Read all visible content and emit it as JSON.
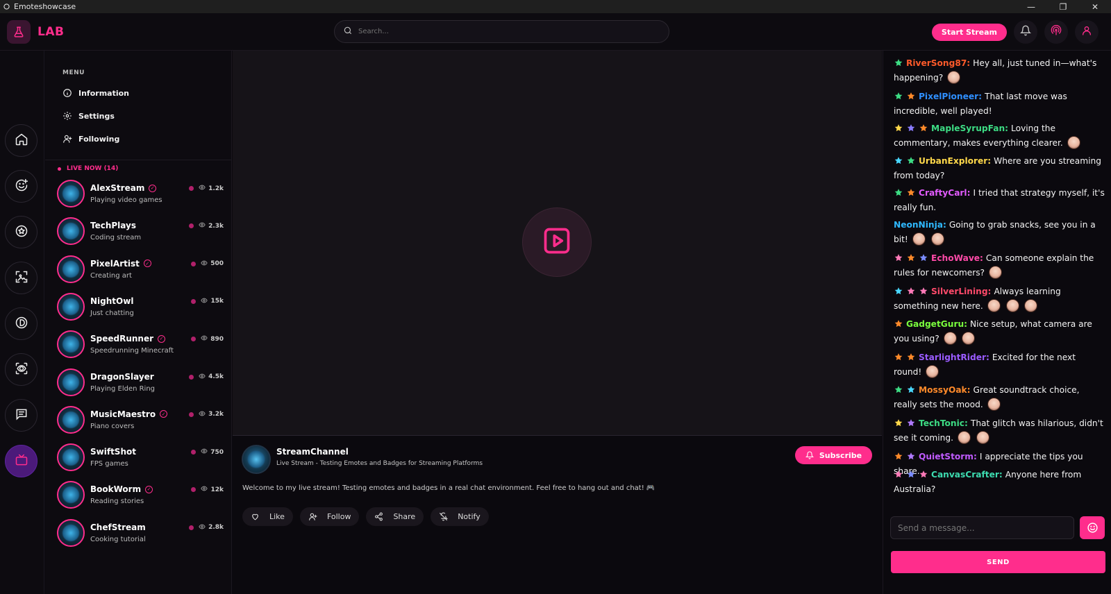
{
  "window": {
    "title": "Emoteshowcase",
    "controls": [
      "—",
      "❐",
      "✕"
    ]
  },
  "header": {
    "logo_text": "LAB",
    "search_placeholder": "Search...",
    "start_stream_label": "Start Stream",
    "accent": "#ff2d8c"
  },
  "menu": {
    "label": "MENU",
    "items": [
      {
        "label": "Information",
        "icon": "info-icon"
      },
      {
        "label": "Settings",
        "icon": "gear-icon"
      },
      {
        "label": "Following",
        "icon": "user-plus-icon"
      }
    ]
  },
  "live_now": {
    "label": "LIVE NOW (14)",
    "streams": [
      {
        "name": "AlexStream",
        "sub": "Playing video games",
        "viewers": "1.2k",
        "verified": true
      },
      {
        "name": "TechPlays",
        "sub": "Coding stream",
        "viewers": "2.3k",
        "verified": false
      },
      {
        "name": "PixelArtist",
        "sub": "Creating art",
        "viewers": "500",
        "verified": true
      },
      {
        "name": "NightOwl",
        "sub": "Just chatting",
        "viewers": "15k",
        "verified": false
      },
      {
        "name": "SpeedRunner",
        "sub": "Speedrunning Minecraft",
        "viewers": "890",
        "verified": true
      },
      {
        "name": "DragonSlayer",
        "sub": "Playing Elden Ring",
        "viewers": "4.5k",
        "verified": false
      },
      {
        "name": "MusicMaestro",
        "sub": "Piano covers",
        "viewers": "3.2k",
        "verified": true
      },
      {
        "name": "SwiftShot",
        "sub": "FPS games",
        "viewers": "750",
        "verified": false
      },
      {
        "name": "BookWorm",
        "sub": "Reading stories",
        "viewers": "12k",
        "verified": true
      },
      {
        "name": "ChefStream",
        "sub": "Cooking tutorial",
        "viewers": "2.8k",
        "verified": false
      }
    ]
  },
  "channel": {
    "name": "StreamChannel",
    "description": "Live Stream - Testing Emotes and Badges for Streaming Platforms",
    "subscribe_label": "Subscribe",
    "welcome": "Welcome to my live stream! Testing emotes and badges in a real chat environment. Feel free to hang out and chat! 🎮",
    "actions": [
      "Like",
      "Follow",
      "Share",
      "Notify"
    ]
  },
  "chat": {
    "messages": [
      {
        "user": "RiverSong87:",
        "color": "#ff5a2a",
        "badges": [
          "#3ddc84"
        ],
        "text": "Hey all, just tuned in—what's happening?",
        "emotes": 1
      },
      {
        "user": "PixelPioneer:",
        "color": "#2f8fff",
        "badges": [
          "#3ddc84",
          "#ff8a2a"
        ],
        "text": "That last move was incredible, well played!",
        "emotes": 0
      },
      {
        "user": "MapleSyrupFan:",
        "color": "#3ddc84",
        "badges": [
          "#ffd84a",
          "#8a7cff",
          "#ff8a2a"
        ],
        "text": "Loving the commentary, makes everything clearer.",
        "emotes": 1
      },
      {
        "user": "UrbanExplorer:",
        "color": "#ffd84a",
        "badges": [
          "#4ad8ff",
          "#3ddc84"
        ],
        "text": "Where are you streaming from today?",
        "emotes": 0
      },
      {
        "user": "CraftyCarl:",
        "color": "#e35bff",
        "badges": [
          "#3ddc84",
          "#ff8a2a"
        ],
        "text": "I tried that strategy myself, it's really fun.",
        "emotes": 0
      },
      {
        "user": "NeonNinja:",
        "color": "#2fb8ff",
        "badges": [],
        "text": "Going to grab snacks, see you in a bit!",
        "emotes": 2
      },
      {
        "user": "EchoWave:",
        "color": "#ff4aa8",
        "badges": [
          "#ff7ab8",
          "#ff8a2a",
          "#7a8cff"
        ],
        "text": "Can someone explain the rules for newcomers?",
        "emotes": 1
      },
      {
        "user": "SilverLining:",
        "color": "#ff4a6a",
        "badges": [
          "#4ad8ff",
          "#ff7ab8",
          "#ff7ab8"
        ],
        "text": "Always learning something new here.",
        "emotes": 3
      },
      {
        "user": "GadgetGuru:",
        "color": "#7aff3d",
        "badges": [
          "#ff8a2a"
        ],
        "text": "Nice setup, what camera are you using?",
        "emotes": 2
      },
      {
        "user": "StarlightRider:",
        "color": "#9a5bff",
        "badges": [
          "#ff8a2a",
          "#ff8a2a"
        ],
        "text": "Excited for the next round!",
        "emotes": 1
      },
      {
        "user": "MossyOak:",
        "color": "#ff8a2a",
        "badges": [
          "#3ddc84",
          "#4ad8ff"
        ],
        "text": "Great soundtrack choice, really sets the mood.",
        "emotes": 1
      },
      {
        "user": "TechTonic:",
        "color": "#3ddc84",
        "badges": [
          "#ffd84a",
          "#b07aff"
        ],
        "text": "That glitch was hilarious, didn't see it coming.",
        "emotes": 2
      },
      {
        "user": "QuietStorm:",
        "color": "#c05bff",
        "badges": [
          "#ff8a2a",
          "#b07aff"
        ],
        "text": "I appreciate the tips you share.",
        "emotes": 0
      },
      {
        "user": "CanvasCrafter:",
        "color": "#3ddcb0",
        "badges": [
          "#ff7ab8",
          "#7a8cff",
          "#ff7ab8"
        ],
        "text": "Anyone here from Australia?",
        "emotes": 0
      }
    ],
    "input_placeholder": "Send a message...",
    "send_label": "SEND"
  }
}
